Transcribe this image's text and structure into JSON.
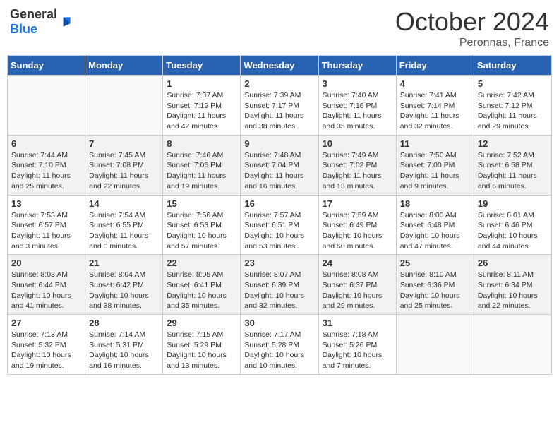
{
  "header": {
    "logo_general": "General",
    "logo_blue": "Blue",
    "month_title": "October 2024",
    "location": "Peronnas, France"
  },
  "days_of_week": [
    "Sunday",
    "Monday",
    "Tuesday",
    "Wednesday",
    "Thursday",
    "Friday",
    "Saturday"
  ],
  "weeks": [
    [
      {
        "day": "",
        "sunrise": "",
        "sunset": "",
        "daylight": ""
      },
      {
        "day": "",
        "sunrise": "",
        "sunset": "",
        "daylight": ""
      },
      {
        "day": "1",
        "sunrise": "Sunrise: 7:37 AM",
        "sunset": "Sunset: 7:19 PM",
        "daylight": "Daylight: 11 hours and 42 minutes."
      },
      {
        "day": "2",
        "sunrise": "Sunrise: 7:39 AM",
        "sunset": "Sunset: 7:17 PM",
        "daylight": "Daylight: 11 hours and 38 minutes."
      },
      {
        "day": "3",
        "sunrise": "Sunrise: 7:40 AM",
        "sunset": "Sunset: 7:16 PM",
        "daylight": "Daylight: 11 hours and 35 minutes."
      },
      {
        "day": "4",
        "sunrise": "Sunrise: 7:41 AM",
        "sunset": "Sunset: 7:14 PM",
        "daylight": "Daylight: 11 hours and 32 minutes."
      },
      {
        "day": "5",
        "sunrise": "Sunrise: 7:42 AM",
        "sunset": "Sunset: 7:12 PM",
        "daylight": "Daylight: 11 hours and 29 minutes."
      }
    ],
    [
      {
        "day": "6",
        "sunrise": "Sunrise: 7:44 AM",
        "sunset": "Sunset: 7:10 PM",
        "daylight": "Daylight: 11 hours and 25 minutes."
      },
      {
        "day": "7",
        "sunrise": "Sunrise: 7:45 AM",
        "sunset": "Sunset: 7:08 PM",
        "daylight": "Daylight: 11 hours and 22 minutes."
      },
      {
        "day": "8",
        "sunrise": "Sunrise: 7:46 AM",
        "sunset": "Sunset: 7:06 PM",
        "daylight": "Daylight: 11 hours and 19 minutes."
      },
      {
        "day": "9",
        "sunrise": "Sunrise: 7:48 AM",
        "sunset": "Sunset: 7:04 PM",
        "daylight": "Daylight: 11 hours and 16 minutes."
      },
      {
        "day": "10",
        "sunrise": "Sunrise: 7:49 AM",
        "sunset": "Sunset: 7:02 PM",
        "daylight": "Daylight: 11 hours and 13 minutes."
      },
      {
        "day": "11",
        "sunrise": "Sunrise: 7:50 AM",
        "sunset": "Sunset: 7:00 PM",
        "daylight": "Daylight: 11 hours and 9 minutes."
      },
      {
        "day": "12",
        "sunrise": "Sunrise: 7:52 AM",
        "sunset": "Sunset: 6:58 PM",
        "daylight": "Daylight: 11 hours and 6 minutes."
      }
    ],
    [
      {
        "day": "13",
        "sunrise": "Sunrise: 7:53 AM",
        "sunset": "Sunset: 6:57 PM",
        "daylight": "Daylight: 11 hours and 3 minutes."
      },
      {
        "day": "14",
        "sunrise": "Sunrise: 7:54 AM",
        "sunset": "Sunset: 6:55 PM",
        "daylight": "Daylight: 11 hours and 0 minutes."
      },
      {
        "day": "15",
        "sunrise": "Sunrise: 7:56 AM",
        "sunset": "Sunset: 6:53 PM",
        "daylight": "Daylight: 10 hours and 57 minutes."
      },
      {
        "day": "16",
        "sunrise": "Sunrise: 7:57 AM",
        "sunset": "Sunset: 6:51 PM",
        "daylight": "Daylight: 10 hours and 53 minutes."
      },
      {
        "day": "17",
        "sunrise": "Sunrise: 7:59 AM",
        "sunset": "Sunset: 6:49 PM",
        "daylight": "Daylight: 10 hours and 50 minutes."
      },
      {
        "day": "18",
        "sunrise": "Sunrise: 8:00 AM",
        "sunset": "Sunset: 6:48 PM",
        "daylight": "Daylight: 10 hours and 47 minutes."
      },
      {
        "day": "19",
        "sunrise": "Sunrise: 8:01 AM",
        "sunset": "Sunset: 6:46 PM",
        "daylight": "Daylight: 10 hours and 44 minutes."
      }
    ],
    [
      {
        "day": "20",
        "sunrise": "Sunrise: 8:03 AM",
        "sunset": "Sunset: 6:44 PM",
        "daylight": "Daylight: 10 hours and 41 minutes."
      },
      {
        "day": "21",
        "sunrise": "Sunrise: 8:04 AM",
        "sunset": "Sunset: 6:42 PM",
        "daylight": "Daylight: 10 hours and 38 minutes."
      },
      {
        "day": "22",
        "sunrise": "Sunrise: 8:05 AM",
        "sunset": "Sunset: 6:41 PM",
        "daylight": "Daylight: 10 hours and 35 minutes."
      },
      {
        "day": "23",
        "sunrise": "Sunrise: 8:07 AM",
        "sunset": "Sunset: 6:39 PM",
        "daylight": "Daylight: 10 hours and 32 minutes."
      },
      {
        "day": "24",
        "sunrise": "Sunrise: 8:08 AM",
        "sunset": "Sunset: 6:37 PM",
        "daylight": "Daylight: 10 hours and 29 minutes."
      },
      {
        "day": "25",
        "sunrise": "Sunrise: 8:10 AM",
        "sunset": "Sunset: 6:36 PM",
        "daylight": "Daylight: 10 hours and 25 minutes."
      },
      {
        "day": "26",
        "sunrise": "Sunrise: 8:11 AM",
        "sunset": "Sunset: 6:34 PM",
        "daylight": "Daylight: 10 hours and 22 minutes."
      }
    ],
    [
      {
        "day": "27",
        "sunrise": "Sunrise: 7:13 AM",
        "sunset": "Sunset: 5:32 PM",
        "daylight": "Daylight: 10 hours and 19 minutes."
      },
      {
        "day": "28",
        "sunrise": "Sunrise: 7:14 AM",
        "sunset": "Sunset: 5:31 PM",
        "daylight": "Daylight: 10 hours and 16 minutes."
      },
      {
        "day": "29",
        "sunrise": "Sunrise: 7:15 AM",
        "sunset": "Sunset: 5:29 PM",
        "daylight": "Daylight: 10 hours and 13 minutes."
      },
      {
        "day": "30",
        "sunrise": "Sunrise: 7:17 AM",
        "sunset": "Sunset: 5:28 PM",
        "daylight": "Daylight: 10 hours and 10 minutes."
      },
      {
        "day": "31",
        "sunrise": "Sunrise: 7:18 AM",
        "sunset": "Sunset: 5:26 PM",
        "daylight": "Daylight: 10 hours and 7 minutes."
      },
      {
        "day": "",
        "sunrise": "",
        "sunset": "",
        "daylight": ""
      },
      {
        "day": "",
        "sunrise": "",
        "sunset": "",
        "daylight": ""
      }
    ]
  ]
}
